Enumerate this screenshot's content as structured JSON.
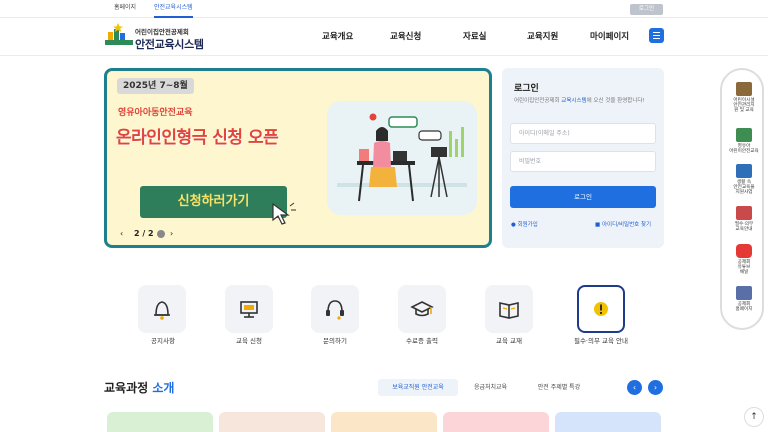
{
  "topbar": {
    "tabs": [
      "홈페이지",
      "안전교육시스템"
    ],
    "login_button": "로그인"
  },
  "header": {
    "logo_sub": "어린이집안전공제회",
    "logo_title": "안전교육시스템",
    "nav": [
      "교육개요",
      "교육신청",
      "자료실",
      "교육지원",
      "마이페이지"
    ]
  },
  "banner": {
    "date": "2025년 7~8월",
    "subtitle": "영유아아동안전교육",
    "title": "온라인인형극 신청 오픈",
    "cta": "신청하러가기",
    "prev": "‹",
    "page": "2 / 2",
    "next": "›"
  },
  "login": {
    "title": "로그인",
    "desc_pre": "어린이집안전공제회 ",
    "desc_brand": "교육시스템",
    "desc_post": "에 오신 것을 환영합니다!",
    "id_placeholder": "아이디(이메일 주소)",
    "pw_placeholder": "비밀번호",
    "button": "로그인",
    "signup": "회원가입",
    "find": "아이디/비밀번호 찾기"
  },
  "quick_menu": [
    {
      "label": "공지사항",
      "icon": "bell-icon"
    },
    {
      "label": "교육 신청",
      "icon": "monitor-icon"
    },
    {
      "label": "문의하기",
      "icon": "headset-icon"
    },
    {
      "label": "수료증 출력",
      "icon": "graduation-cap-icon"
    },
    {
      "label": "교육 교재",
      "icon": "book-icon"
    },
    {
      "label": "필수·의무 교육 안내",
      "icon": "alert-icon"
    }
  ],
  "course": {
    "title_main": "교육과정",
    "title_accent": "소개",
    "tabs": [
      "보육교직원 안전교육",
      "응급처치교육",
      "안전 주제별 특강"
    ]
  },
  "side_bar": [
    {
      "label": "어린이시설\n안전관리지\n원 및 교육"
    },
    {
      "label": "영유아\n어린이안전교육"
    },
    {
      "label": "생활 속\n안전교육을\n지원사업"
    },
    {
      "label": "필수·의무\n교육안내"
    },
    {
      "label": "공제회\n유튜브\n채널"
    },
    {
      "label": "공제회\n홈페이지"
    }
  ],
  "colors": {
    "primary": "#1f6fe0",
    "banner_border": "#1e7f8f",
    "banner_bg": "#fdf6cf",
    "banner_text": "#e0443a",
    "cta_bg": "#2e7d5b"
  }
}
